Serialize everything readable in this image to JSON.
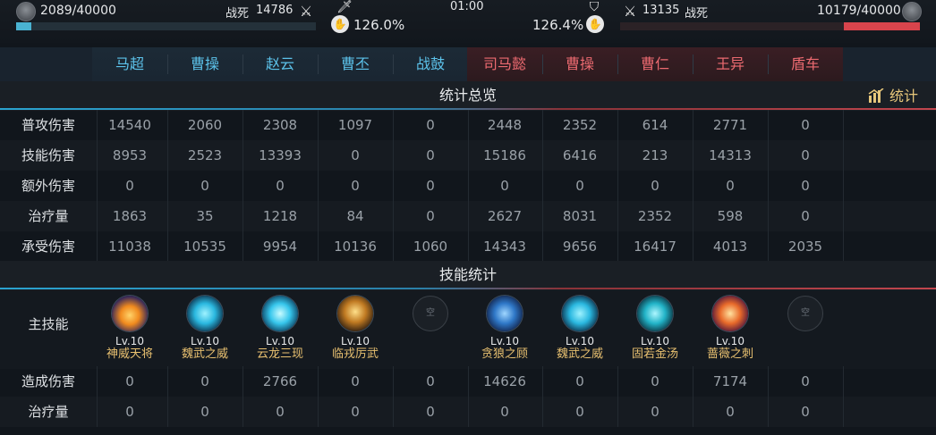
{
  "top": {
    "left_hp": "2089/40000",
    "left_hp_fraction": 0.052,
    "left_kills_label": "战死",
    "left_kills": "14786",
    "timer": "01:00",
    "left_pct": "126.0%",
    "right_pct": "126.4%",
    "right_kills": "13135",
    "right_kills_label": "战死",
    "right_hp": "10179/40000",
    "right_hp_fraction": 0.254
  },
  "heroes_left": [
    "马超",
    "曹操",
    "赵云",
    "曹丕",
    "战鼓"
  ],
  "heroes_right": [
    "司马懿",
    "曹操",
    "曹仁",
    "王异",
    "盾车"
  ],
  "section_overview": "统计总览",
  "stats_button": "统计",
  "rows": [
    {
      "label": "普攻伤害",
      "values": [
        "14540",
        "2060",
        "2308",
        "1097",
        "0",
        "2448",
        "2352",
        "614",
        "2771",
        "0"
      ]
    },
    {
      "label": "技能伤害",
      "values": [
        "8953",
        "2523",
        "13393",
        "0",
        "0",
        "15186",
        "6416",
        "213",
        "14313",
        "0"
      ]
    },
    {
      "label": "额外伤害",
      "values": [
        "0",
        "0",
        "0",
        "0",
        "0",
        "0",
        "0",
        "0",
        "0",
        "0"
      ]
    },
    {
      "label": "治疗量",
      "values": [
        "1863",
        "35",
        "1218",
        "84",
        "0",
        "2627",
        "8031",
        "2352",
        "598",
        "0"
      ]
    },
    {
      "label": "承受伤害",
      "values": [
        "11038",
        "10535",
        "9954",
        "10136",
        "1060",
        "14343",
        "9656",
        "16417",
        "4013",
        "2035"
      ]
    }
  ],
  "section_skills": "技能统计",
  "main_skill_label": "主技能",
  "skills": [
    {
      "lv": "Lv.10",
      "name": "神威天将",
      "icon": "flame-warrior-icon",
      "empty": false
    },
    {
      "lv": "Lv.10",
      "name": "魏武之威",
      "icon": "cyan-lord-icon",
      "empty": false
    },
    {
      "lv": "Lv.10",
      "name": "云龙三现",
      "icon": "dragon-icon",
      "empty": false
    },
    {
      "lv": "Lv.10",
      "name": "临戎厉武",
      "icon": "golden-warrior-icon",
      "empty": false
    },
    {
      "lv": "",
      "name": "",
      "icon": "empty-slot-icon",
      "empty": true,
      "empty_text": "空"
    },
    {
      "lv": "Lv.10",
      "name": "贪狼之顾",
      "icon": "wolf-icon",
      "empty": false
    },
    {
      "lv": "Lv.10",
      "name": "魏武之威",
      "icon": "cyan-lord-icon",
      "empty": false
    },
    {
      "lv": "Lv.10",
      "name": "固若金汤",
      "icon": "shield-icon",
      "empty": false
    },
    {
      "lv": "Lv.10",
      "name": "蔷薇之刺",
      "icon": "rose-blade-icon",
      "empty": false
    },
    {
      "lv": "",
      "name": "",
      "icon": "empty-slot-icon",
      "empty": true,
      "empty_text": "空"
    }
  ],
  "skill_rows": [
    {
      "label": "造成伤害",
      "values": [
        "0",
        "0",
        "2766",
        "0",
        "0",
        "14626",
        "0",
        "0",
        "7174",
        "0"
      ]
    },
    {
      "label": "治疗量",
      "values": [
        "0",
        "0",
        "0",
        "0",
        "0",
        "0",
        "0",
        "0",
        "0",
        "0"
      ]
    }
  ],
  "colors": {
    "blue_team": "#5cc2ea",
    "red_team": "#ec6a70",
    "skill_name": "#e8c070"
  }
}
